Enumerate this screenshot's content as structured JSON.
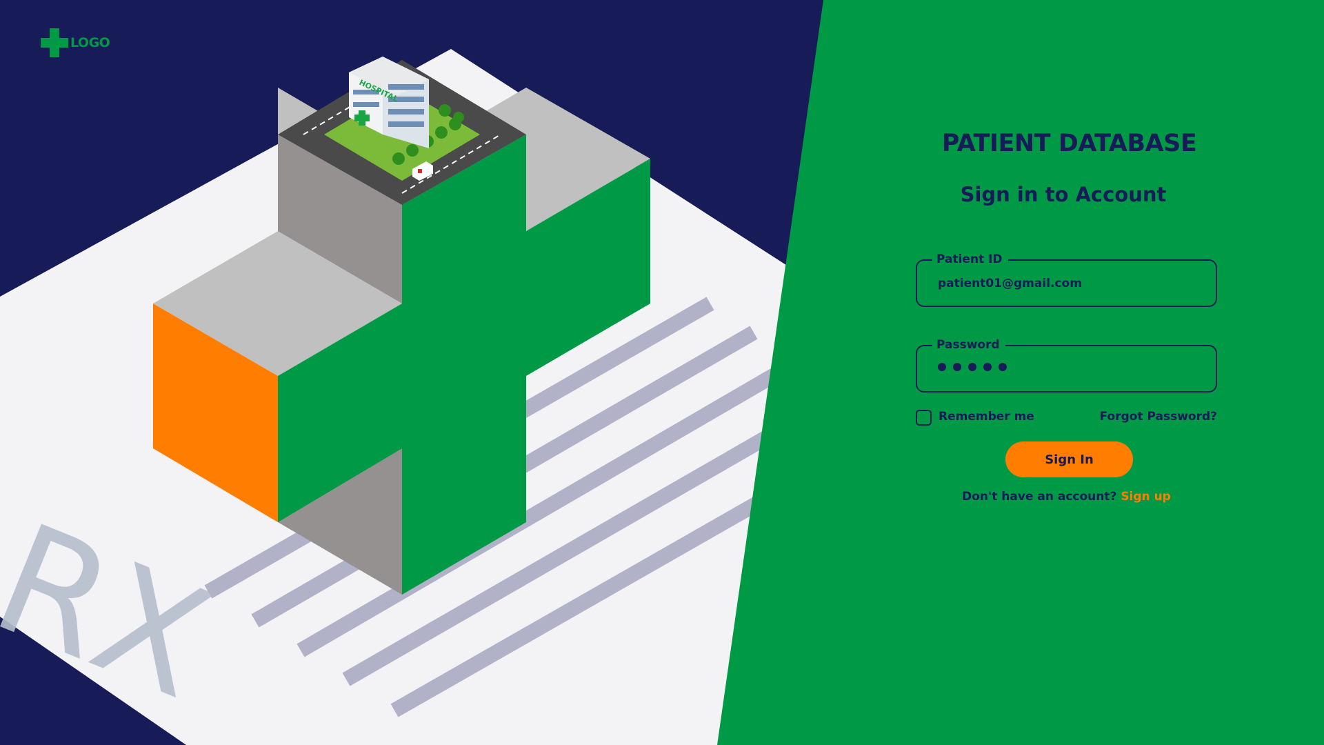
{
  "logo": {
    "text": "LOGO"
  },
  "illustration": {
    "rx_text": "RX",
    "building_sign": "HOSPITAL"
  },
  "form": {
    "title": "PATIENT DATABASE",
    "subtitle": "Sign in to Account",
    "patient_id": {
      "label": "Patient ID",
      "value": "patient01@gmail.com"
    },
    "password": {
      "label": "Password",
      "masked_length": 5
    },
    "remember_label": "Remember me",
    "remember_checked": false,
    "forgot_label": "Forgot Password?",
    "sign_in_label": "Sign In",
    "signup_prompt": "Don't have an account?",
    "signup_link": "Sign up"
  },
  "colors": {
    "navy": "#171b57",
    "green": "#009a47",
    "orange": "#ff7d00",
    "paper": "#f3f2f4",
    "stripe": "#b1b2c8",
    "gray_top": "#c1c0c1",
    "gray_side": "#949190"
  }
}
